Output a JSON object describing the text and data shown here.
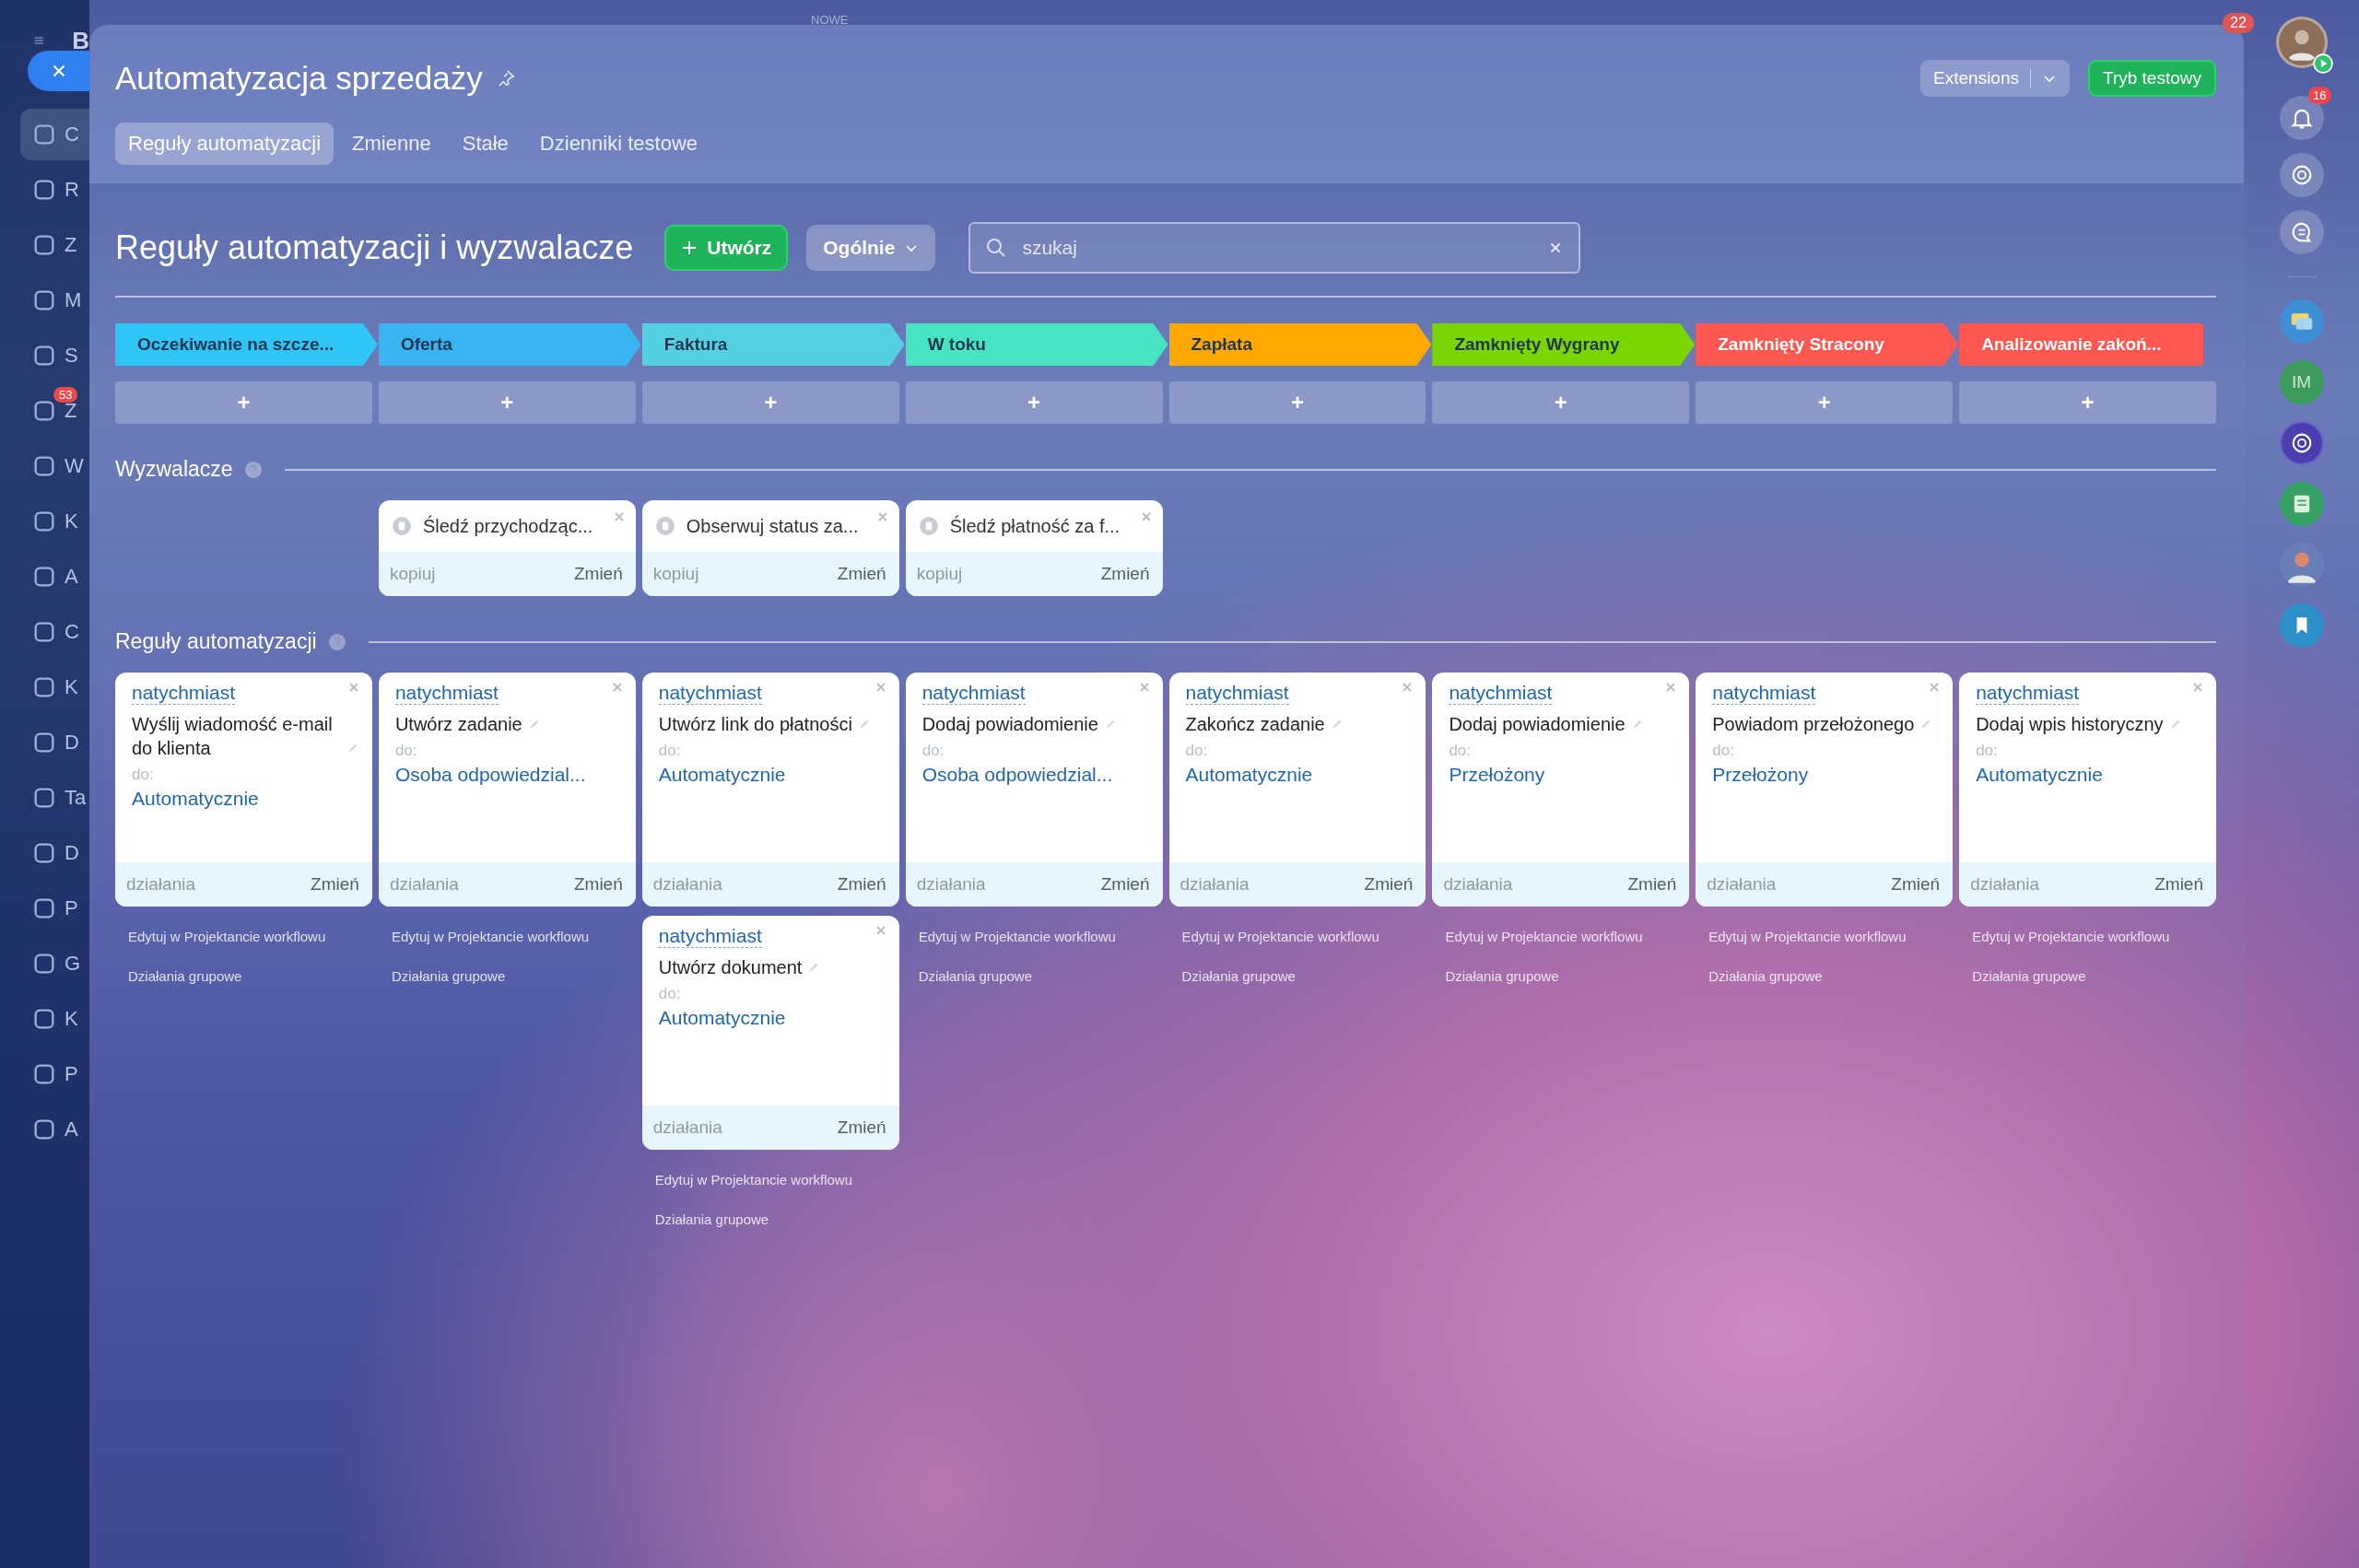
{
  "top_bar": {
    "logo": "B",
    "new_label": "NOWE",
    "counter": "22"
  },
  "sidebar": {
    "items": [
      {
        "label": "C",
        "selected": true
      },
      {
        "label": "R",
        "selected": false
      },
      {
        "label": "Z",
        "selected": false
      },
      {
        "label": "M",
        "selected": false
      },
      {
        "label": "S",
        "selected": false
      },
      {
        "label": "Z",
        "selected": false,
        "badge": "53"
      },
      {
        "label": "W",
        "selected": false
      },
      {
        "label": "K",
        "selected": false
      },
      {
        "label": "A",
        "selected": false
      },
      {
        "label": "C",
        "selected": false
      },
      {
        "label": "K",
        "selected": false
      },
      {
        "label": "D",
        "selected": false
      },
      {
        "label": "Ta",
        "selected": false
      },
      {
        "label": "D",
        "selected": false
      },
      {
        "label": "P",
        "selected": false
      },
      {
        "label": "G",
        "selected": false
      },
      {
        "label": "K",
        "selected": false
      },
      {
        "label": "P",
        "selected": false
      },
      {
        "label": "A",
        "selected": false
      }
    ]
  },
  "panel": {
    "title": "Automatyzacja sprzedaży",
    "extensions_button": "Extensions",
    "test_mode_button": "Tryb testowy",
    "tabs": [
      {
        "label": "Reguły automatyzacji",
        "selected": true
      },
      {
        "label": "Zmienne",
        "selected": false
      },
      {
        "label": "Stałe",
        "selected": false
      },
      {
        "label": "Dzienniki testowe",
        "selected": false
      }
    ],
    "heading": "Reguły automatyzacji i wyzwalacze",
    "create_button": "Utwórz",
    "filter_button": "Ogólnie",
    "search": {
      "placeholder": "szukaj"
    },
    "triggers_title": "Wyzwalacze",
    "rules_title": "Reguły automatyzacji",
    "add_label": "+",
    "stages": [
      {
        "label": "Oczekiwanie na szcze...",
        "color": "#2fc6f6",
        "rules": [
          {
            "timing": "natychmiast",
            "title": "Wyślij wiadomość e-mail do klienta",
            "to_label": "do:",
            "to": "Automatycznie",
            "actions": "działania",
            "change": "Zmień"
          }
        ],
        "links": [
          "Edytuj w Projektancie workflowu",
          "Działania grupowe"
        ]
      },
      {
        "label": "Oferta",
        "color": "#39b4f1",
        "triggers": [
          {
            "title": "Śledź przychodząc...",
            "copy": "kopiuj",
            "change": "Zmień"
          }
        ],
        "rules": [
          {
            "timing": "natychmiast",
            "title": "Utwórz zadanie",
            "to_label": "do:",
            "to": "Osoba odpowiedzial...",
            "actions": "działania",
            "change": "Zmień"
          }
        ],
        "links": [
          "Edytuj w Projektancie workflowu",
          "Działania grupowe"
        ]
      },
      {
        "label": "Faktura",
        "color": "#55d0e0",
        "triggers": [
          {
            "title": "Obserwuj status za...",
            "copy": "kopiuj",
            "change": "Zmień"
          }
        ],
        "rules": [
          {
            "timing": "natychmiast",
            "title": "Utwórz link do płatności",
            "to_label": "do:",
            "to": "Automatycznie",
            "actions": "działania",
            "change": "Zmień"
          },
          {
            "timing": "natychmiast",
            "title": "Utwórz dokument",
            "to_label": "do:",
            "to": "Automatycznie",
            "actions": "działania",
            "change": "Zmień"
          }
        ],
        "links": [
          "Edytuj w Projektancie workflowu",
          "Działania grupowe"
        ]
      },
      {
        "label": "W toku",
        "color": "#47e4c2",
        "triggers": [
          {
            "title": "Śledź płatność za f...",
            "copy": "kopiuj",
            "change": "Zmień"
          }
        ],
        "rules": [
          {
            "timing": "natychmiast",
            "title": "Dodaj powiadomienie",
            "to_label": "do:",
            "to": "Osoba odpowiedzial...",
            "actions": "działania",
            "change": "Zmień"
          }
        ],
        "links": [
          "Edytuj w Projektancie workflowu",
          "Działania grupowe"
        ]
      },
      {
        "label": "Zapłata",
        "color": "#ffa900",
        "rules": [
          {
            "timing": "natychmiast",
            "title": "Zakończ zadanie",
            "to_label": "do:",
            "to": "Automatycznie",
            "actions": "działania",
            "change": "Zmień"
          }
        ],
        "links": [
          "Edytuj w Projektancie workflowu",
          "Działania grupowe"
        ]
      },
      {
        "label": "Zamknięty Wygrany",
        "color": "#7bd500",
        "rules": [
          {
            "timing": "natychmiast",
            "title": "Dodaj powiadomienie",
            "to_label": "do:",
            "to": "Przełożony",
            "actions": "działania",
            "change": "Zmień"
          }
        ],
        "links": [
          "Edytuj w Projektancie workflowu",
          "Działania grupowe"
        ]
      },
      {
        "label": "Zamknięty Stracony",
        "color": "#ff5752",
        "rules": [
          {
            "timing": "natychmiast",
            "title": "Powiadom przełożonego",
            "to_label": "do:",
            "to": "Przełożony",
            "actions": "działania",
            "change": "Zmień"
          }
        ],
        "links": [
          "Edytuj w Projektancie workflowu",
          "Działania grupowe"
        ]
      },
      {
        "label": "Analizowanie zakoń...",
        "color": "#ff5752",
        "rules": [
          {
            "timing": "natychmiast",
            "title": "Dodaj wpis historyczny",
            "to_label": "do:",
            "to": "Automatycznie",
            "actions": "działania",
            "change": "Zmień"
          }
        ],
        "links": [
          "Edytuj w Projektancie workflowu",
          "Działania grupowe"
        ]
      }
    ]
  },
  "right_rail": {
    "notification_count": "16",
    "contact_initials": "IM"
  }
}
